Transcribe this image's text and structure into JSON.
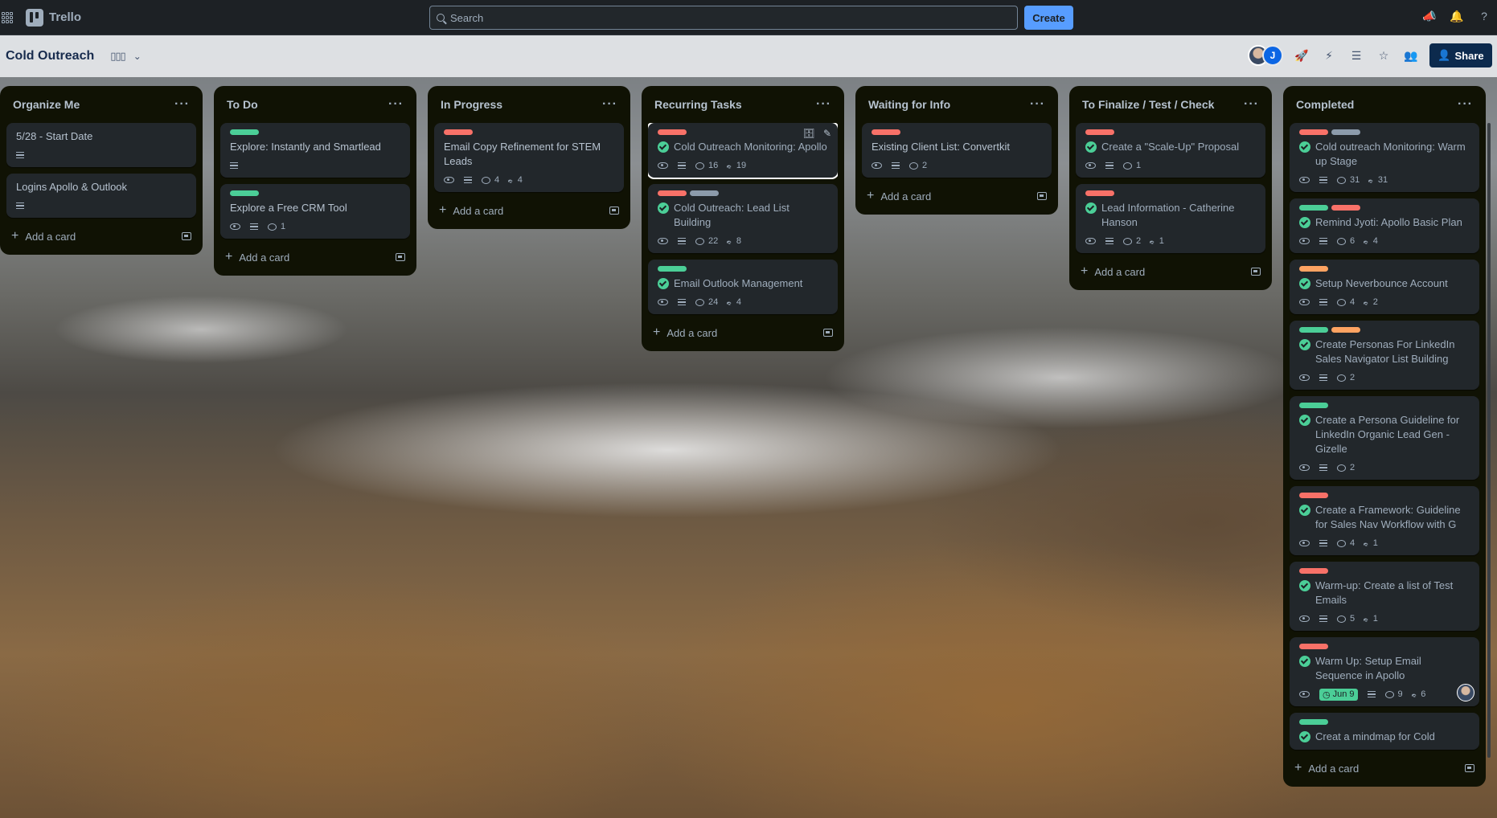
{
  "app": {
    "name": "Trello"
  },
  "search": {
    "placeholder": "Search"
  },
  "topbar": {
    "create_label": "Create"
  },
  "board": {
    "title": "Cold Outreach",
    "share_label": "Share",
    "members": [
      {
        "initial": ""
      },
      {
        "initial": "J"
      }
    ]
  },
  "colors": {
    "green": "#4bce97",
    "red": "#f87168",
    "grey": "#8c9bab",
    "orange": "#fea362",
    "accent": "#579dff"
  },
  "lists": [
    {
      "title": "Organize Me",
      "add_label": "Add a card",
      "cards": [
        {
          "title": "5/28 - Start Date",
          "labels": [],
          "done": false,
          "desc": true
        },
        {
          "title": "Logins Apollo & Outlook",
          "labels": [],
          "done": false,
          "desc": true
        }
      ]
    },
    {
      "title": "To Do",
      "add_label": "Add a card",
      "cards": [
        {
          "title": "Explore: Instantly and Smartlead",
          "labels": [
            "green"
          ],
          "done": false,
          "desc": true
        },
        {
          "title": "Explore a Free CRM Tool",
          "labels": [
            "green"
          ],
          "done": false,
          "watch": true,
          "desc": true,
          "comments": "1"
        }
      ]
    },
    {
      "title": "In Progress",
      "add_label": "Add a card",
      "cards": [
        {
          "title": "Email Copy Refinement for STEM Leads",
          "labels": [
            "red"
          ],
          "done": false,
          "watch": true,
          "desc": true,
          "comments": "4",
          "attachments": "4"
        }
      ]
    },
    {
      "title": "Recurring Tasks",
      "add_label": "Add a card",
      "cards": [
        {
          "title": "Cold Outreach Monitoring: Apollo",
          "labels": [
            "red"
          ],
          "done": true,
          "watch": true,
          "desc": true,
          "comments": "16",
          "attachments": "19",
          "selected": true
        },
        {
          "title": "Cold Outreach: Lead List Building",
          "labels": [
            "red",
            "grey"
          ],
          "done": true,
          "watch": true,
          "desc": true,
          "comments": "22",
          "attachments": "8"
        },
        {
          "title": "Email Outlook Management",
          "labels": [
            "green"
          ],
          "done": true,
          "watch": true,
          "desc": true,
          "comments": "24",
          "attachments": "4"
        }
      ]
    },
    {
      "title": "Waiting for Info",
      "add_label": "Add a card",
      "cards": [
        {
          "title": "Existing Client List: Convertkit",
          "labels": [
            "red"
          ],
          "done": false,
          "watch": true,
          "desc": true,
          "comments": "2"
        }
      ]
    },
    {
      "title": "To Finalize / Test / Check",
      "add_label": "Add a card",
      "cards": [
        {
          "title": "Create a \"Scale-Up\" Proposal",
          "labels": [
            "red"
          ],
          "done": true,
          "watch": true,
          "desc": true,
          "comments": "1"
        },
        {
          "title": "Lead Information - Catherine Hanson",
          "labels": [
            "red"
          ],
          "done": true,
          "watch": true,
          "desc": true,
          "comments": "2",
          "attachments": "1"
        }
      ]
    },
    {
      "title": "Completed",
      "add_label": "Add a card",
      "cards": [
        {
          "title": "Cold outreach Monitoring: Warm up Stage",
          "labels": [
            "red",
            "grey"
          ],
          "done": true,
          "watch": true,
          "desc": true,
          "comments": "31",
          "attachments": "31"
        },
        {
          "title": "Remind Jyoti: Apollo Basic Plan",
          "labels": [
            "green",
            "red"
          ],
          "done": true,
          "watch": true,
          "desc": true,
          "comments": "6",
          "attachments": "4"
        },
        {
          "title": "Setup Neverbounce Account",
          "labels": [
            "orange"
          ],
          "done": true,
          "watch": true,
          "desc": true,
          "comments": "4",
          "attachments": "2"
        },
        {
          "title": "Create Personas For LinkedIn Sales Navigator List Building",
          "labels": [
            "green",
            "orange"
          ],
          "done": true,
          "watch": true,
          "desc": true,
          "comments": "2"
        },
        {
          "title": "Create a Persona Guideline for LinkedIn Organic Lead Gen - Gizelle",
          "labels": [
            "green"
          ],
          "done": true,
          "watch": true,
          "desc": true,
          "comments": "2"
        },
        {
          "title": "Create a Framework: Guideline for Sales Nav Workflow with G",
          "labels": [
            "red"
          ],
          "done": true,
          "watch": true,
          "desc": true,
          "comments": "4",
          "attachments": "1"
        },
        {
          "title": "Warm-up: Create a list of Test Emails",
          "labels": [
            "red"
          ],
          "done": true,
          "watch": true,
          "desc": true,
          "comments": "5",
          "attachments": "1"
        },
        {
          "title": "Warm Up: Setup Email Sequence in Apollo",
          "labels": [
            "red"
          ],
          "done": true,
          "watch": true,
          "due": "Jun 9",
          "desc": true,
          "comments": "9",
          "attachments": "6",
          "member": true
        },
        {
          "title": "Creat a mindmap for Cold Outreach",
          "labels": [
            "green"
          ],
          "done": true
        }
      ]
    }
  ]
}
